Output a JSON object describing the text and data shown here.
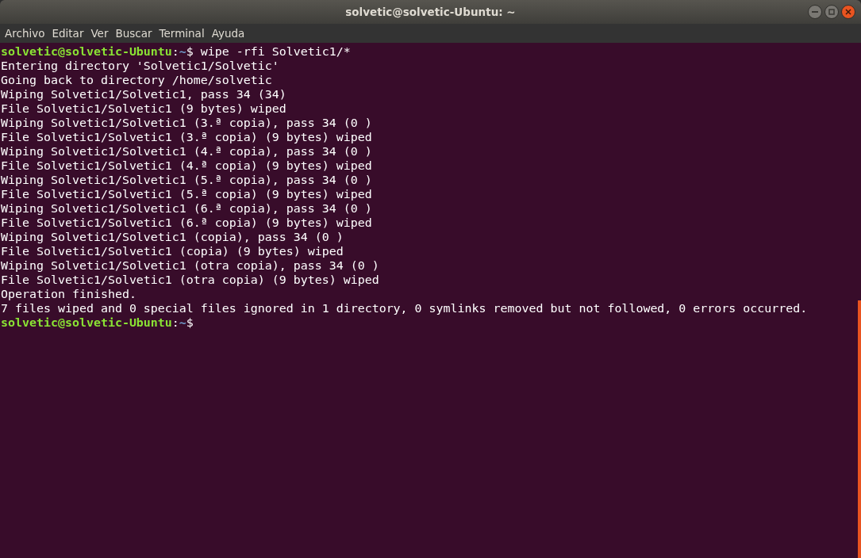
{
  "window": {
    "title": "solvetic@solvetic-Ubuntu: ~"
  },
  "menu": [
    "Archivo",
    "Editar",
    "Ver",
    "Buscar",
    "Terminal",
    "Ayuda"
  ],
  "lines": [
    {
      "kind": "prompt",
      "user_host": "solvetic@solvetic-Ubuntu",
      "separator": ":",
      "path": "~",
      "command": "$ wipe -rfi Solvetic1/*"
    },
    {
      "kind": "output",
      "text": "Entering directory 'Solvetic1/Solvetic'"
    },
    {
      "kind": "output",
      "text": "Going back to directory /home/solvetic"
    },
    {
      "kind": "output",
      "text": "Wiping Solvetic1/Solvetic1, pass 34 (34)"
    },
    {
      "kind": "output",
      "text": "File Solvetic1/Solvetic1 (9 bytes) wiped"
    },
    {
      "kind": "output",
      "text": "Wiping Solvetic1/Solvetic1 (3.ª copia), pass 34 (0 )"
    },
    {
      "kind": "output",
      "text": "File Solvetic1/Solvetic1 (3.ª copia) (9 bytes) wiped"
    },
    {
      "kind": "output",
      "text": "Wiping Solvetic1/Solvetic1 (4.ª copia), pass 34 (0 )"
    },
    {
      "kind": "output",
      "text": "File Solvetic1/Solvetic1 (4.ª copia) (9 bytes) wiped"
    },
    {
      "kind": "output",
      "text": "Wiping Solvetic1/Solvetic1 (5.ª copia), pass 34 (0 )"
    },
    {
      "kind": "output",
      "text": "File Solvetic1/Solvetic1 (5.ª copia) (9 bytes) wiped"
    },
    {
      "kind": "output",
      "text": "Wiping Solvetic1/Solvetic1 (6.ª copia), pass 34 (0 )"
    },
    {
      "kind": "output",
      "text": "File Solvetic1/Solvetic1 (6.ª copia) (9 bytes) wiped"
    },
    {
      "kind": "output",
      "text": "Wiping Solvetic1/Solvetic1 (copia), pass 34 (0 )"
    },
    {
      "kind": "output",
      "text": "File Solvetic1/Solvetic1 (copia) (9 bytes) wiped"
    },
    {
      "kind": "output",
      "text": "Wiping Solvetic1/Solvetic1 (otra copia), pass 34 (0 )"
    },
    {
      "kind": "output",
      "text": "File Solvetic1/Solvetic1 (otra copia) (9 bytes) wiped"
    },
    {
      "kind": "output",
      "text": "Operation finished."
    },
    {
      "kind": "output",
      "text": "7 files wiped and 0 special files ignored in 1 directory, 0 symlinks removed but not followed, 0 errors occurred."
    },
    {
      "kind": "prompt",
      "user_host": "solvetic@solvetic-Ubuntu",
      "separator": ":",
      "path": "~",
      "command": "$"
    }
  ]
}
